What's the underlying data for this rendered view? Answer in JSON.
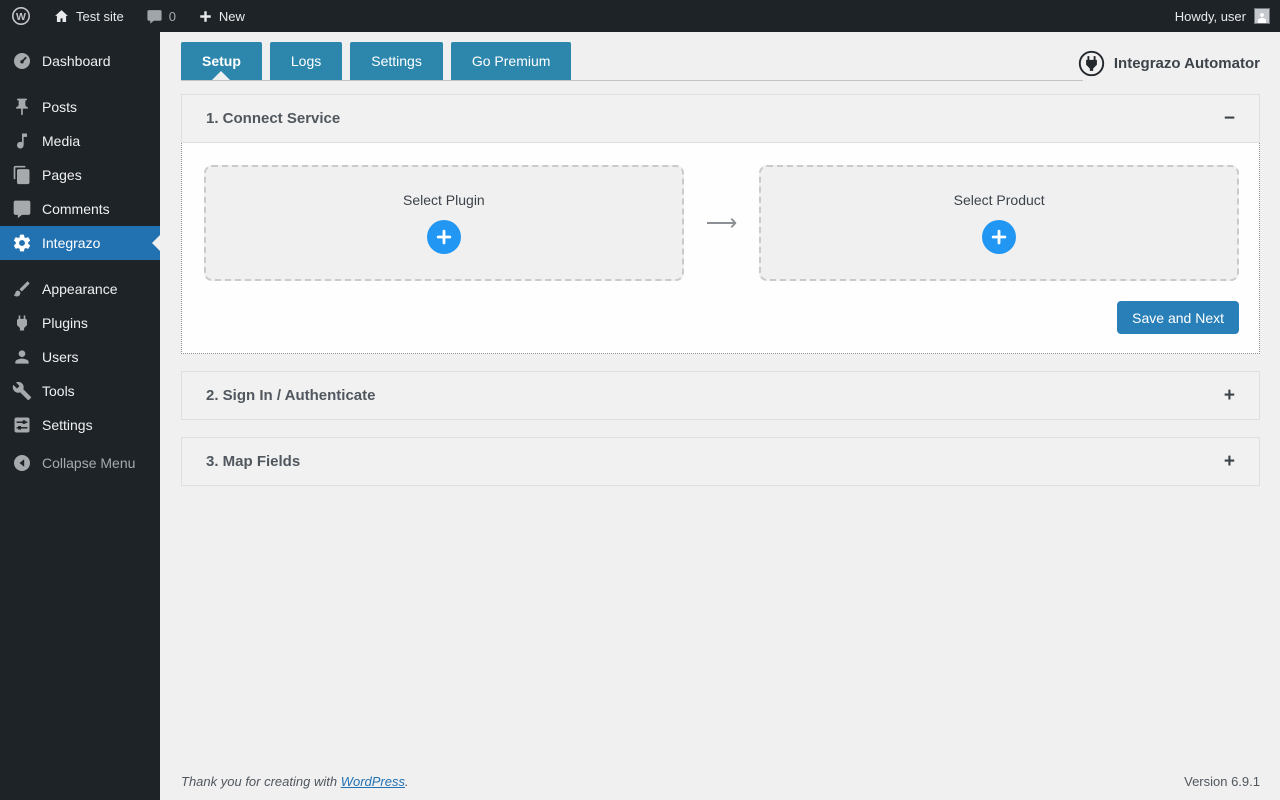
{
  "admin_bar": {
    "site_name": "Test site",
    "comment_count": "0",
    "new_label": "New",
    "howdy_text": "Howdy, user"
  },
  "sidebar": {
    "items": [
      {
        "label": "Dashboard",
        "icon": "dashboard-icon"
      },
      {
        "label": "Posts",
        "icon": "pin-icon"
      },
      {
        "label": "Media",
        "icon": "media-icon"
      },
      {
        "label": "Pages",
        "icon": "pages-icon"
      },
      {
        "label": "Comments",
        "icon": "comments-icon"
      },
      {
        "label": "Integrazo",
        "icon": "gear-icon",
        "active": true
      },
      {
        "label": "Appearance",
        "icon": "appearance-icon"
      },
      {
        "label": "Plugins",
        "icon": "plugin-icon"
      },
      {
        "label": "Users",
        "icon": "users-icon"
      },
      {
        "label": "Tools",
        "icon": "tools-icon"
      },
      {
        "label": "Settings",
        "icon": "settings-icon"
      }
    ],
    "collapse_label": "Collapse Menu"
  },
  "main": {
    "title": "Integrazo Automator",
    "tabs": [
      {
        "label": "Setup",
        "active": true
      },
      {
        "label": "Logs",
        "active": false
      },
      {
        "label": "Settings",
        "active": false
      },
      {
        "label": "Go Premium",
        "active": false
      }
    ],
    "sections": [
      {
        "title": "1. Connect Service",
        "toggle": "−",
        "state": "expanded"
      },
      {
        "title": "2. Sign In / Authenticate",
        "toggle": "+",
        "state": "collapsed"
      },
      {
        "title": "3. Map Fields",
        "toggle": "+",
        "state": "collapsed"
      }
    ],
    "connect_service": {
      "plugin_card": "Select Plugin",
      "product_card": "Select Product",
      "arrow": "⟶",
      "save_button": "Save and Next"
    }
  },
  "footer": {
    "thanks_prefix": "Thank you for creating with ",
    "link_label": "WordPress",
    "thanks_suffix": ".",
    "version": "Version 6.9.1"
  },
  "colors": {
    "admin_bar_bg": "#1d2327",
    "menu_highlight_blue": "#2271b1",
    "tab_blue": "#2d87ad",
    "plus_circle_blue": "#2196f3",
    "save_button_blue": "#2980b9",
    "page_bg": "#f0f0f1"
  }
}
